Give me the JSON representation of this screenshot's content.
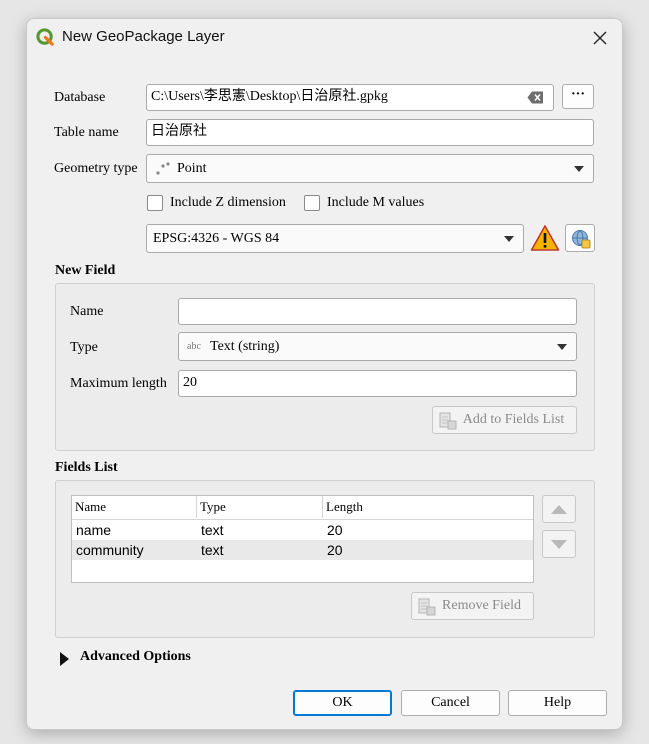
{
  "window": {
    "title": "New GeoPackage Layer"
  },
  "form": {
    "database_label": "Database",
    "database_value": "C:\\Users\\李思憲\\Desktop\\日治原社.gpkg",
    "browse_label": "···",
    "table_name_label": "Table name",
    "table_name_value": "日治原社",
    "geometry_type_label": "Geometry type",
    "geometry_type_value": "Point",
    "include_z_label": "Include Z dimension",
    "include_m_label": "Include M values",
    "crs_value": "EPSG:4326 - WGS 84"
  },
  "new_field": {
    "title": "New Field",
    "name_label": "Name",
    "name_value": "",
    "type_label": "Type",
    "type_prefix": "abc",
    "type_value": "Text (string)",
    "max_length_label": "Maximum length",
    "max_length_value": "20",
    "add_button": "Add to Fields List"
  },
  "fields_list": {
    "title": "Fields List",
    "columns": [
      "Name",
      "Type",
      "Length"
    ],
    "rows": [
      {
        "name": "name",
        "type": "text",
        "length": "20"
      },
      {
        "name": "community",
        "type": "text",
        "length": "20"
      }
    ],
    "remove_button": "Remove Field"
  },
  "advanced": {
    "label": "Advanced Options"
  },
  "buttons": {
    "ok": "OK",
    "cancel": "Cancel",
    "help": "Help"
  },
  "colors": {
    "accent": "#0078d4",
    "qgis_green": "#589632",
    "warning": "#f5b400"
  }
}
